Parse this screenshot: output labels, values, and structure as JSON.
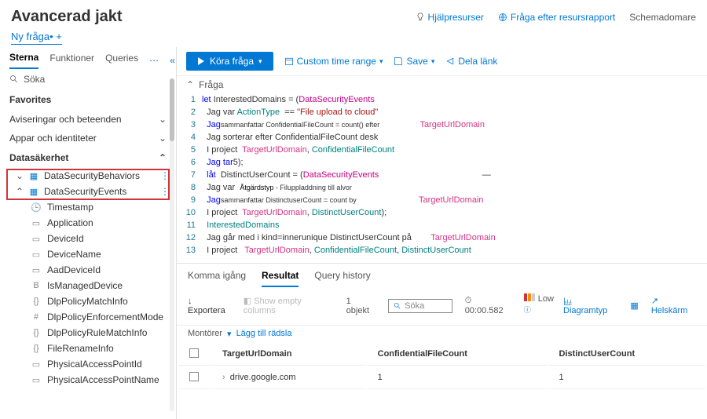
{
  "header": {
    "title": "Avancerad jakt",
    "help": "Hjälpresurser",
    "resource": "Fråga efter resursrapport",
    "schema": "Schemadomare"
  },
  "newQuery": "Ny fråga• +",
  "sidebar": {
    "tabs": {
      "schema": "Sterna",
      "functions": "Funktioner",
      "queries": "Queries"
    },
    "searchLabel": "Söka",
    "favorites": "Favorites",
    "sections": {
      "alerts": "Aviseringar och beteenden",
      "apps": "Appar och identiteter",
      "datasec": "Datasäkerhet"
    },
    "tables": {
      "behaviors": "DataSecurityBehaviors",
      "events": "DataSecurityEvents"
    },
    "cols": [
      {
        "icon": "🕒",
        "name": "Timestamp"
      },
      {
        "icon": "▭",
        "name": "Application"
      },
      {
        "icon": "▭",
        "name": "DeviceId"
      },
      {
        "icon": "▭",
        "name": "DeviceName"
      },
      {
        "icon": "▭",
        "name": "AadDeviceId"
      },
      {
        "icon": "B",
        "name": "IsManagedDevice"
      },
      {
        "icon": "{}",
        "name": "DlpPolicyMatchInfo"
      },
      {
        "icon": "#",
        "name": "DlpPolicyEnforcementMode"
      },
      {
        "icon": "{}",
        "name": "DlpPolicyRuleMatchInfo"
      },
      {
        "icon": "{}",
        "name": "FileRenameInfo"
      },
      {
        "icon": "▭",
        "name": "PhysicalAccessPointId"
      },
      {
        "icon": "▭",
        "name": "PhysicalAccessPointName"
      }
    ]
  },
  "toolbar": {
    "run": "Köra fråga",
    "timerange": "Custom time range",
    "save": "Save",
    "share": "Dela länk"
  },
  "queryLabel": "Fråga",
  "code": {
    "1": {
      "pre": "let ",
      "mid": "InterestedDomains = (",
      "ent": "DataSecurityEvents"
    },
    "2a": "Jag var ",
    "2b": "ActionType",
    "2c": "  == ",
    "2d": "\"File upload to cloud\"",
    "3a": "Jag",
    "3b": "sammanfattar",
    "3c": " ConfidentialFileCount = count() efter ",
    "3d": "TargetUrlDomain",
    "4": "Jag sorterar efter ConfidentialFileCount desk",
    "5a": "I project  ",
    "5b": "TargetUrlDomain",
    "5c": ", ",
    "5d": "ConfidentialFileCount",
    "6": "Jag tar",
    "6b": "5);",
    "7a": "låt  ",
    "7b": "DistinctUserCount = (",
    "7c": "DataSecurityEvents",
    "8a": "Jag var  ",
    "8b": "Åtgärdstyp",
    "8c": " - Filuppladdning till alvor",
    "9a": "Jag",
    "9b": "sammanfattar",
    "9c": " DistinctuserCount = count by",
    "9d": "TargetUrlDomain",
    "10a": "I project  ",
    "10b": "TargetUrlDomain",
    "10c": ", ",
    "10d": "DistinctUserCount",
    "10e": ");",
    "11": "InterestedDomains",
    "12a": "Jag går med i kind=innerunique DistinctUserCount på",
    "12b": "TargetUrlDomain",
    "13a": "I project   ",
    "13b": "TargetUrlDomain",
    "13c": ", ",
    "13d": "ConfidentialFileCount",
    "13e": ", ",
    "13f": "DistinctUserCount"
  },
  "results": {
    "tabs": {
      "getstarted": "Komma igång",
      "results": "Resultat",
      "history": "Query history"
    },
    "export": "Exportera",
    "showempty": "Show empty columns",
    "count": "1 objekt",
    "searchPH": "Söka",
    "time": "00:00.582",
    "low": "Low",
    "chart": "Diagramtyp",
    "fullscreen": "Helskärm",
    "filters": "Montörer",
    "addfilter": "Lägg till rädsla",
    "headers": {
      "c1": "TargetUrlDomain",
      "c2": "ConfidentialFileCount",
      "c3": "DistinctUserCount"
    },
    "row": {
      "c1": "drive.google.com",
      "c2": "1",
      "c3": "1"
    }
  }
}
